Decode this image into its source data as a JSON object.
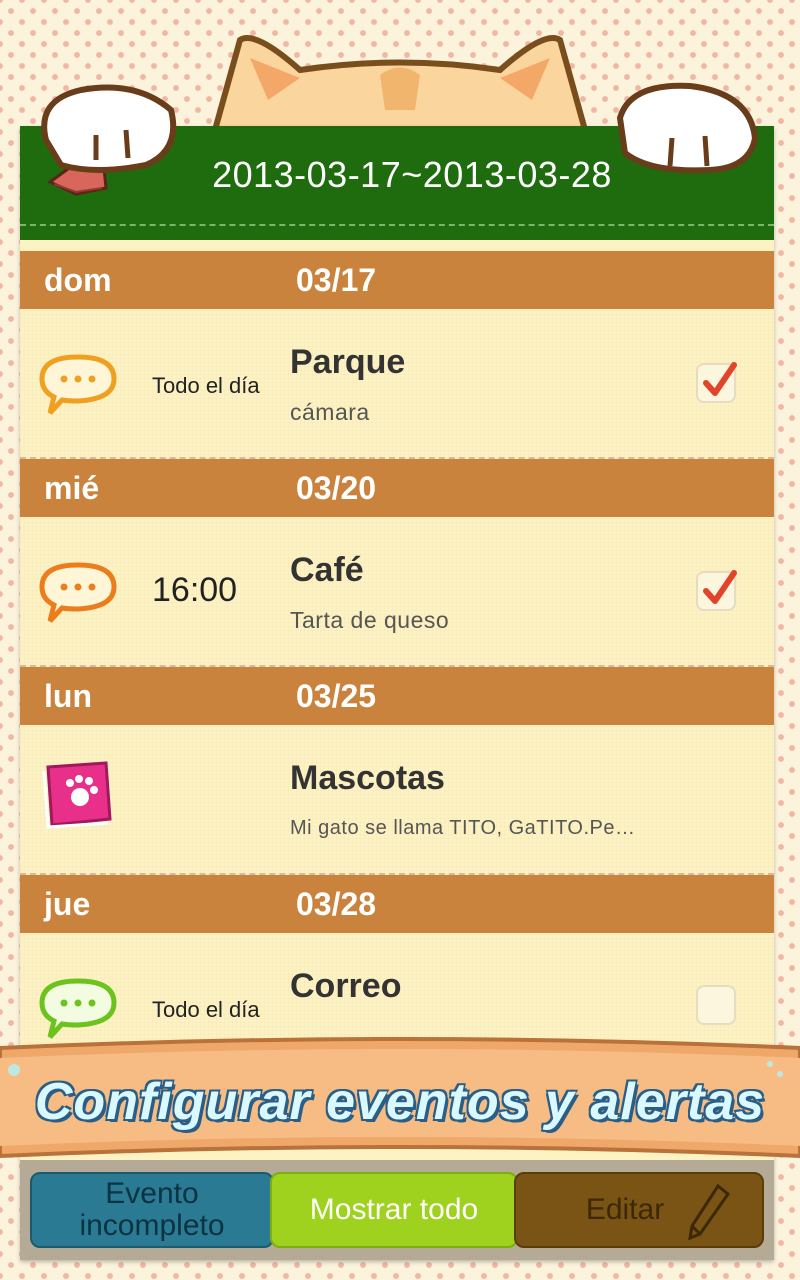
{
  "header": {
    "date_range": "2013-03-17~2013-03-28"
  },
  "days": [
    {
      "day_name": "dom",
      "date": "03/17",
      "event": {
        "icon": "speech-bubble-orange-icon",
        "time": "Todo el día",
        "title": "Parque",
        "note": "cámara",
        "checked": true
      }
    },
    {
      "day_name": "mié",
      "date": "03/20",
      "event": {
        "icon": "speech-bubble-orange-icon",
        "time": "16:00",
        "title": "Café",
        "note": "Tarta de queso",
        "checked": true
      }
    },
    {
      "day_name": "lun",
      "date": "03/25",
      "event": {
        "icon": "pink-pet-book-icon",
        "time": "",
        "title": "Mascotas",
        "note": "Mi gato se llama TITO, GaTITO.Pe…",
        "checked": null
      }
    },
    {
      "day_name": "jue",
      "date": "03/28",
      "event": {
        "icon": "speech-bubble-green-icon",
        "time": "Todo el día",
        "title": "Correo",
        "note": "",
        "checked": false
      }
    }
  ],
  "banner": {
    "text": "Configurar eventos y alertas"
  },
  "tabs": {
    "incomplete_line1": "Evento",
    "incomplete_line2": "incompleto",
    "show_all": "Mostrar todo",
    "edit": "Editar"
  },
  "colors": {
    "header_green": "#1f6c0e",
    "day_header": "#c9833c",
    "show_all_tab": "#9fd11f",
    "incomplete_tab": "#2a7a93",
    "edit_tab": "#7a5414"
  }
}
